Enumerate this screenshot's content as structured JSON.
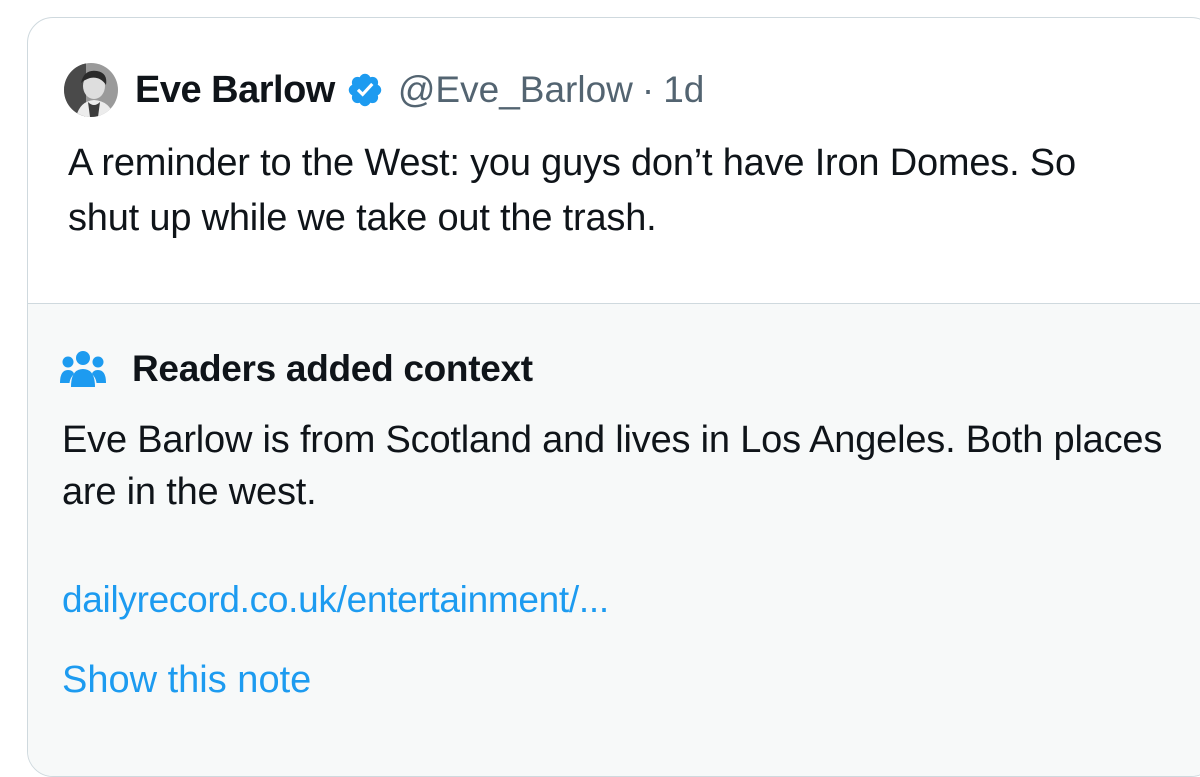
{
  "tweet": {
    "author_name": "Eve Barlow",
    "handle": "@Eve_Barlow",
    "separator": "·",
    "time": "1d",
    "verified": true,
    "text": "A reminder to the West: you guys don’t have Iron Domes. So shut up while we take out the trash."
  },
  "community_note": {
    "title": "Readers added context",
    "body": "Eve Barlow is from Scotland and lives in Los Angeles. Both places are in the west.",
    "link_text": "dailyrecord.co.uk/entertainment/...",
    "show_note_label": "Show this note"
  },
  "icons": {
    "avatar": "author-avatar",
    "verified": "verified-badge-icon",
    "context": "people-icon"
  },
  "colors": {
    "text": "#0f1419",
    "secondary": "#536471",
    "accent": "#1d9bf0",
    "border": "#cfd9de",
    "note_background": "#f7f9f9"
  }
}
